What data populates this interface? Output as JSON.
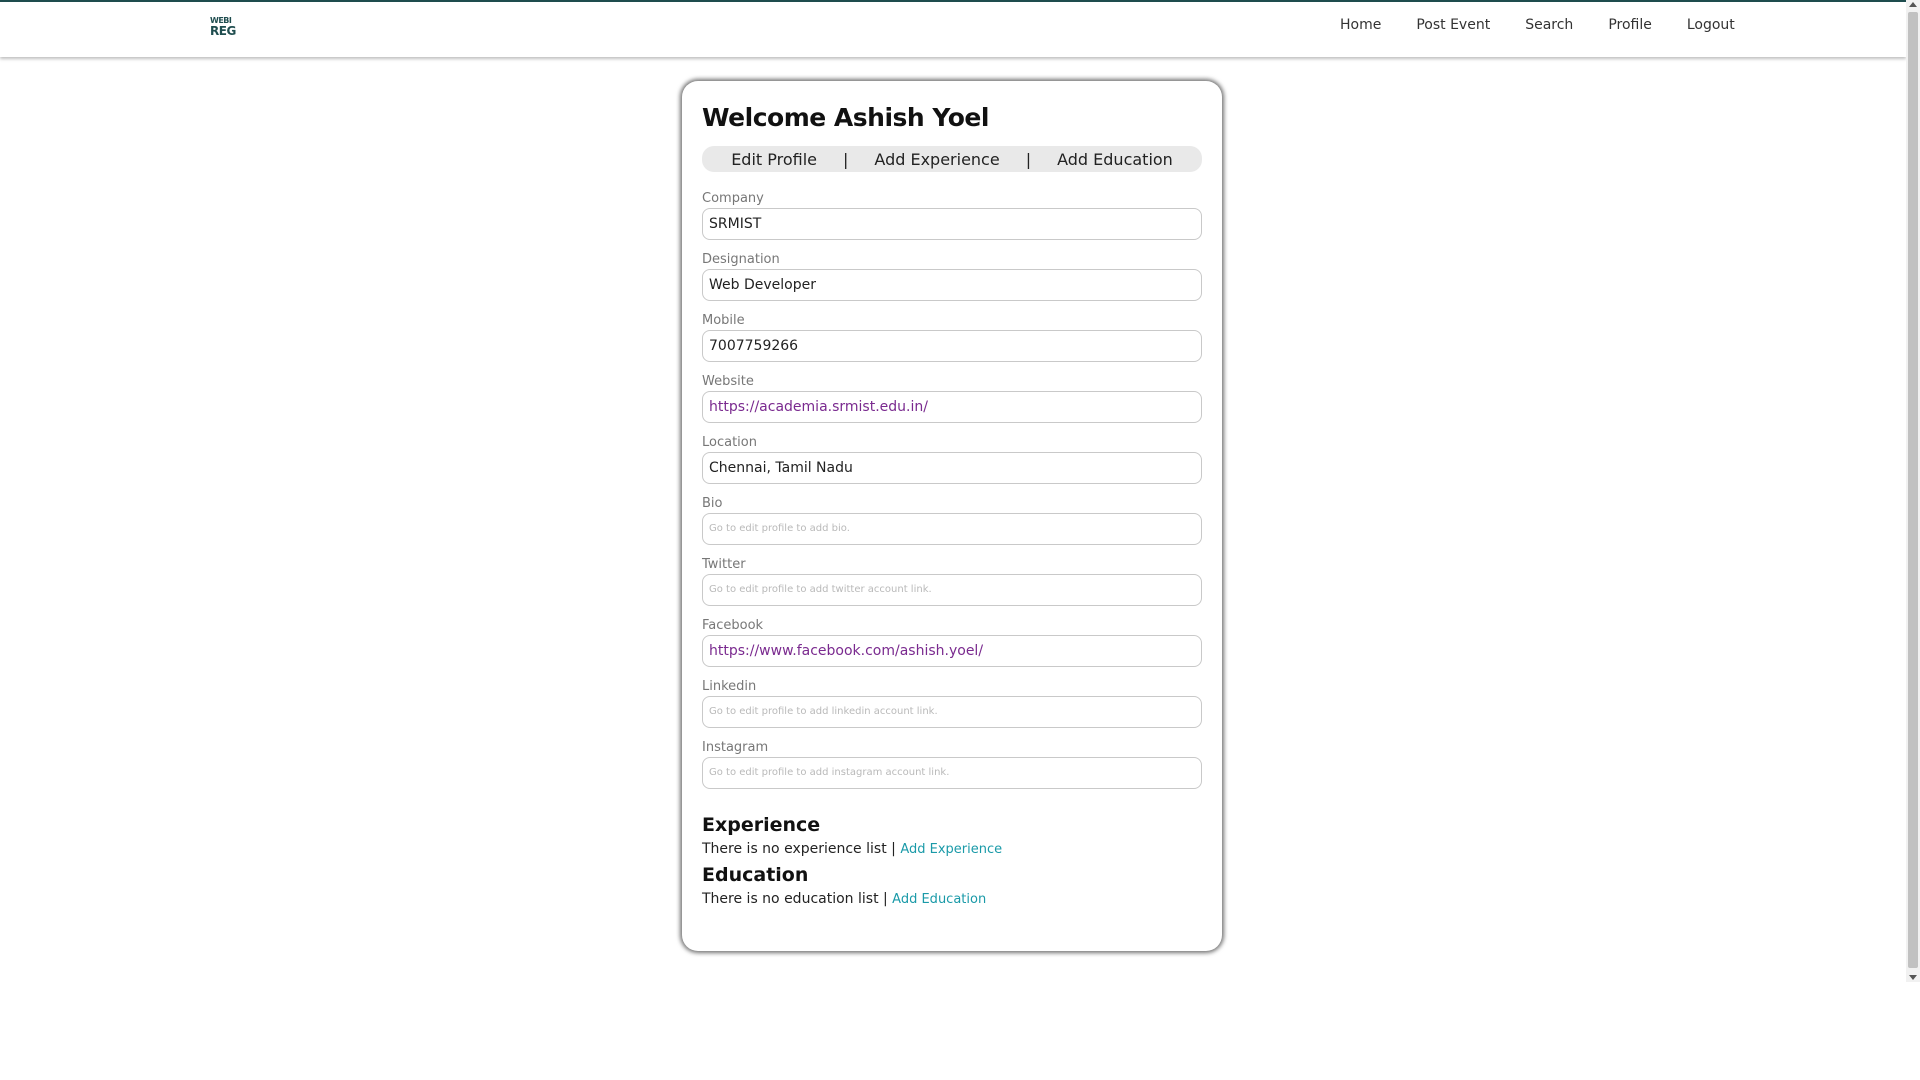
{
  "navbar": {
    "logo_line1": "WEBI",
    "logo_line2": "REG",
    "links": [
      "Home",
      "Post Event",
      "Search",
      "Profile",
      "Logout"
    ]
  },
  "profile": {
    "welcome": "Welcome Ashish Yoel",
    "tabs": [
      "Edit Profile",
      "Add Experience",
      "Add Education"
    ],
    "tab_separator": "|",
    "fields": [
      {
        "label": "Company",
        "value": "SRMIST",
        "kind": "value"
      },
      {
        "label": "Designation",
        "value": "Web Developer",
        "kind": "value"
      },
      {
        "label": "Mobile",
        "value": "7007759266",
        "kind": "value"
      },
      {
        "label": "Website",
        "value": "https://academia.srmist.edu.in/",
        "kind": "link"
      },
      {
        "label": "Location",
        "value": "Chennai, Tamil Nadu",
        "kind": "value"
      },
      {
        "label": "Bio",
        "value": "Go to edit profile to add bio.",
        "kind": "placeholder"
      },
      {
        "label": "Twitter",
        "value": "Go to edit profile to add twitter account link.",
        "kind": "placeholder"
      },
      {
        "label": "Facebook",
        "value": "https://www.facebook.com/ashish.yoel/",
        "kind": "link"
      },
      {
        "label": "Linkedin",
        "value": "Go to edit profile to add linkedin account link.",
        "kind": "placeholder"
      },
      {
        "label": "Instagram",
        "value": "Go to edit profile to add instagram account link.",
        "kind": "placeholder"
      }
    ],
    "experience": {
      "title": "Experience",
      "empty_text": "There is no experience list |",
      "link": "Add Experience"
    },
    "education": {
      "title": "Education",
      "empty_text": "There is no education list |",
      "link": "Add Education"
    }
  },
  "colors": {
    "brand": "#1f4d4f",
    "link_purple": "#7a2a8f",
    "link_teal": "#1a9aa8"
  }
}
